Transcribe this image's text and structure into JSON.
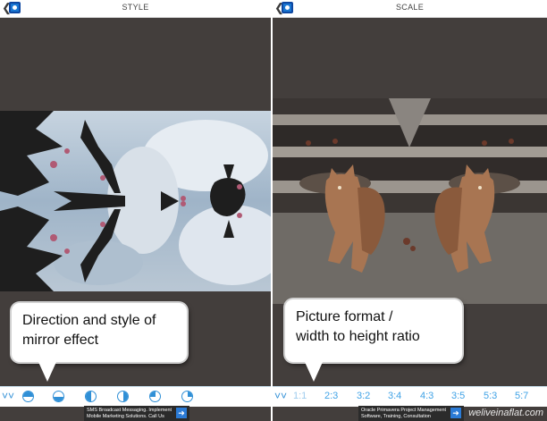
{
  "left_screen": {
    "title": "STYLE",
    "callout": {
      "line1": "Direction and style of",
      "line2": "mirror effect"
    },
    "toolbar": {
      "collapse_icon": "double-chevron-down-icon",
      "buttons": [
        {
          "icon": "mirror-top-half-icon"
        },
        {
          "icon": "mirror-bottom-half-icon"
        },
        {
          "icon": "mirror-left-half-icon"
        },
        {
          "icon": "mirror-right-half-icon"
        },
        {
          "icon": "mirror-quarter-icon"
        },
        {
          "icon": "mirror-quarter-alt-icon"
        }
      ]
    },
    "ad": {
      "line1": "SMS Broadcast Messaging. Implement",
      "line2": "Mobile Marketing Solutions. Call Us"
    }
  },
  "right_screen": {
    "title": "SCALE",
    "callout": {
      "line1": "Picture format /",
      "line2": "width to height ratio"
    },
    "toolbar": {
      "collapse_icon": "double-chevron-down-icon",
      "ratios": [
        "1:1",
        "2:3",
        "3:2",
        "3:4",
        "4:3",
        "3:5",
        "5:3",
        "5:7"
      ],
      "selected": "1:1"
    },
    "ad": {
      "line1": "Oracle Primavera Project Management",
      "line2": "Software, Training, Consultation"
    },
    "watermark": "weliveinaflat.com"
  },
  "colors": {
    "accent": "#2f8fd6",
    "background": "#433e3c",
    "topbar": "#ffffff"
  }
}
